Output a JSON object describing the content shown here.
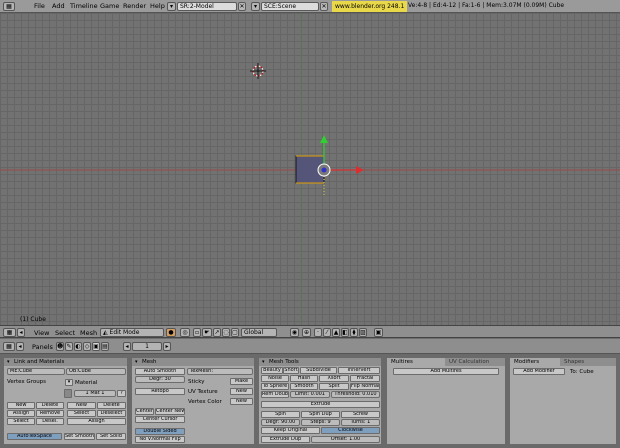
{
  "menu": {
    "items": [
      "File",
      "Add",
      "Timeline",
      "Game",
      "Render",
      "Help"
    ],
    "screen": "SR:2-Model",
    "scene": "SCE:Scene",
    "url": "www.blender.org 248.1",
    "stats": "Ve:4-8 | Ed:4-12 | Fa:1-6 | Mem:3.07M (0.09M) Cube"
  },
  "viewport": {
    "object_label": "(1) Cube",
    "colors": {
      "x_axis": "#c83232",
      "y_axis": "#32c832",
      "z_axis": "#3232c8",
      "selected": "#ffa000"
    }
  },
  "header3d": {
    "view": "View",
    "select": "Select",
    "mesh": "Mesh",
    "mode": "Edit Mode",
    "orientation": "Global"
  },
  "buttons_header": {
    "panels": "Panels",
    "frame": "1"
  },
  "link_materials": {
    "title": "Link and Materials",
    "me": "ME:Cube",
    "ob": "OB:Cube",
    "vertex_groups": "Vertex Groups",
    "material": "Material",
    "mat_count": "1 Mat 1",
    "question": "?",
    "new1": "New",
    "delete1": "Delete",
    "assign1": "Assign",
    "remove": "Remove",
    "select1": "Select",
    "deselect1": "Desel.",
    "new2": "New",
    "delete2": "Delete",
    "select2": "Select",
    "deselect2": "Deselect",
    "assign2": "Assign",
    "autotexspace": "AutoTexSpace",
    "set_smooth": "Set Smooth",
    "set_solid": "Set Solid"
  },
  "mesh": {
    "title": "Mesh",
    "auto_smooth": "Auto Smooth",
    "degr": "Degr: 30",
    "retopo": "Retopo",
    "texmesh": "TexMesh:",
    "sticky": "Sticky",
    "make": "Make",
    "uv_texture": "UV Texture",
    "new_uv": "New",
    "vertex_color": "Vertex Color",
    "new_vc": "New",
    "center_new": "Center New",
    "center": "Center",
    "center_cursor": "Center Cursor",
    "double_sided": "Double Sided",
    "no_v_normal_flip": "No V.Normal Flip"
  },
  "mesh_tools": {
    "title": "Mesh Tools",
    "beauty": "Beauty",
    "short": "Short",
    "subdivide": "Subdivide",
    "innervert": "Innervert",
    "noise": "Noise",
    "hash": "Hash",
    "xsort": "Xsort",
    "fractal": "Fractal",
    "to_sphere": "To Sphere",
    "smooth": "Smooth",
    "split": "Split",
    "flip_normals": "Flip Normals",
    "rem_double": "Rem Double",
    "limit": "Limit: 0.001",
    "threshold": "Threshold: 0.010",
    "extrude": "Extrude",
    "spin": "Spin",
    "spin_dup": "Spin Dup",
    "screw": "Screw",
    "degr": "Degr: 90.00",
    "steps": "Steps: 9",
    "turns": "Turns: 1",
    "keep_original": "Keep Original",
    "clockwise": "Clockwise",
    "extrude_dup": "Extrude Dup",
    "offset": "Offset: 1.00"
  },
  "multires": {
    "tab1": "Multires",
    "tab2": "UV Calculation",
    "add_multires": "Add Multires"
  },
  "modifiers": {
    "tab1": "Modifiers",
    "tab2": "Shapes",
    "add_modifier": "Add Modifier",
    "to_cube": "To: Cube"
  }
}
